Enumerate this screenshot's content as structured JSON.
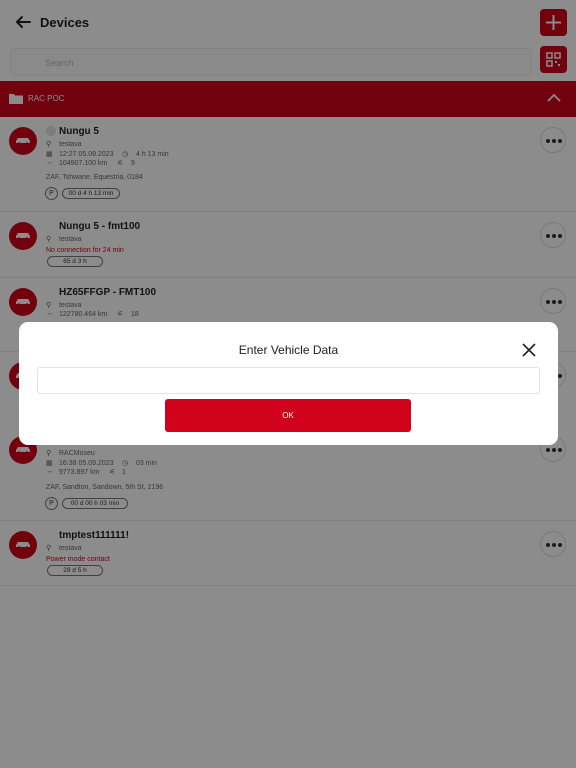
{
  "header": {
    "title": "Devices"
  },
  "search": {
    "placeholder": "Search"
  },
  "group": {
    "label": "RAC POC"
  },
  "devices": [
    {
      "name": "Nungu 5",
      "user": "testava",
      "datetime": "12:27 05.09.2023",
      "duration": "4 h 13 min",
      "odometer": "104907.100 km",
      "satellites": "9",
      "address": "ZAF, Tshwane, Equestria, 0184",
      "parked_label": "P",
      "parked_time": "00 d 4 h 13 min"
    },
    {
      "name": "Nungu 5 - fmt100",
      "user": "testava",
      "status": "No connection for 24 min",
      "badge": "65 d 3 h"
    },
    {
      "name": "HZ65FFGP - FMT100",
      "user": "testava",
      "odometer": "122780.464 km",
      "satellites": "18"
    },
    {
      "user": "RACMoseu",
      "datetime": "16:38 05.09.2023",
      "duration": "03 min",
      "odometer": "9773.897 km",
      "satellites": "1",
      "address": "ZAF, Sandton, Sandown, 5th St, 2196",
      "parked_label": "P",
      "parked_time": "00 d 00 h 03 min"
    },
    {
      "name": "tmptest111111!",
      "user": "testava",
      "status": "Power mode contact",
      "badge": "29 d 5 h"
    }
  ],
  "modal": {
    "title": "Enter Vehicle Data",
    "input_value": "",
    "ok_label": "OK"
  },
  "colors": {
    "brand": "#d0021b",
    "overlay": "rgba(0,0,0,0.45)"
  },
  "icons": [
    "back-arrow-icon",
    "plus-icon",
    "qr-scan-icon",
    "folder-icon",
    "chevron-up-icon",
    "car-icon",
    "key-icon",
    "calendar-icon",
    "clock-icon",
    "odometer-icon",
    "satellite-icon",
    "more-icon",
    "close-icon"
  ]
}
